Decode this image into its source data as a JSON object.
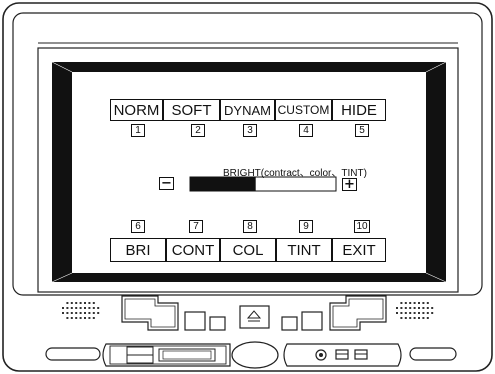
{
  "menu_top": [
    {
      "label": "NORM",
      "num": "1"
    },
    {
      "label": "SOFT",
      "num": "2"
    },
    {
      "label": "DYNAM",
      "num": "3"
    },
    {
      "label": "CUSTOM",
      "num": "4"
    },
    {
      "label": "HIDE",
      "num": "5"
    }
  ],
  "menu_bottom": [
    {
      "label": "BRI",
      "num": "6"
    },
    {
      "label": "CONT",
      "num": "7"
    },
    {
      "label": "COL",
      "num": "8"
    },
    {
      "label": "TINT",
      "num": "9"
    },
    {
      "label": "EXIT",
      "num": "10"
    }
  ],
  "adjust": {
    "label": "BRIGHT(contract、color、TINT)",
    "minus": "−",
    "plus": "+",
    "level": 0.45
  },
  "icons": {
    "eject": "eject-icon",
    "speaker_left": "speaker-grille-icon",
    "speaker_right": "speaker-grille-icon"
  }
}
